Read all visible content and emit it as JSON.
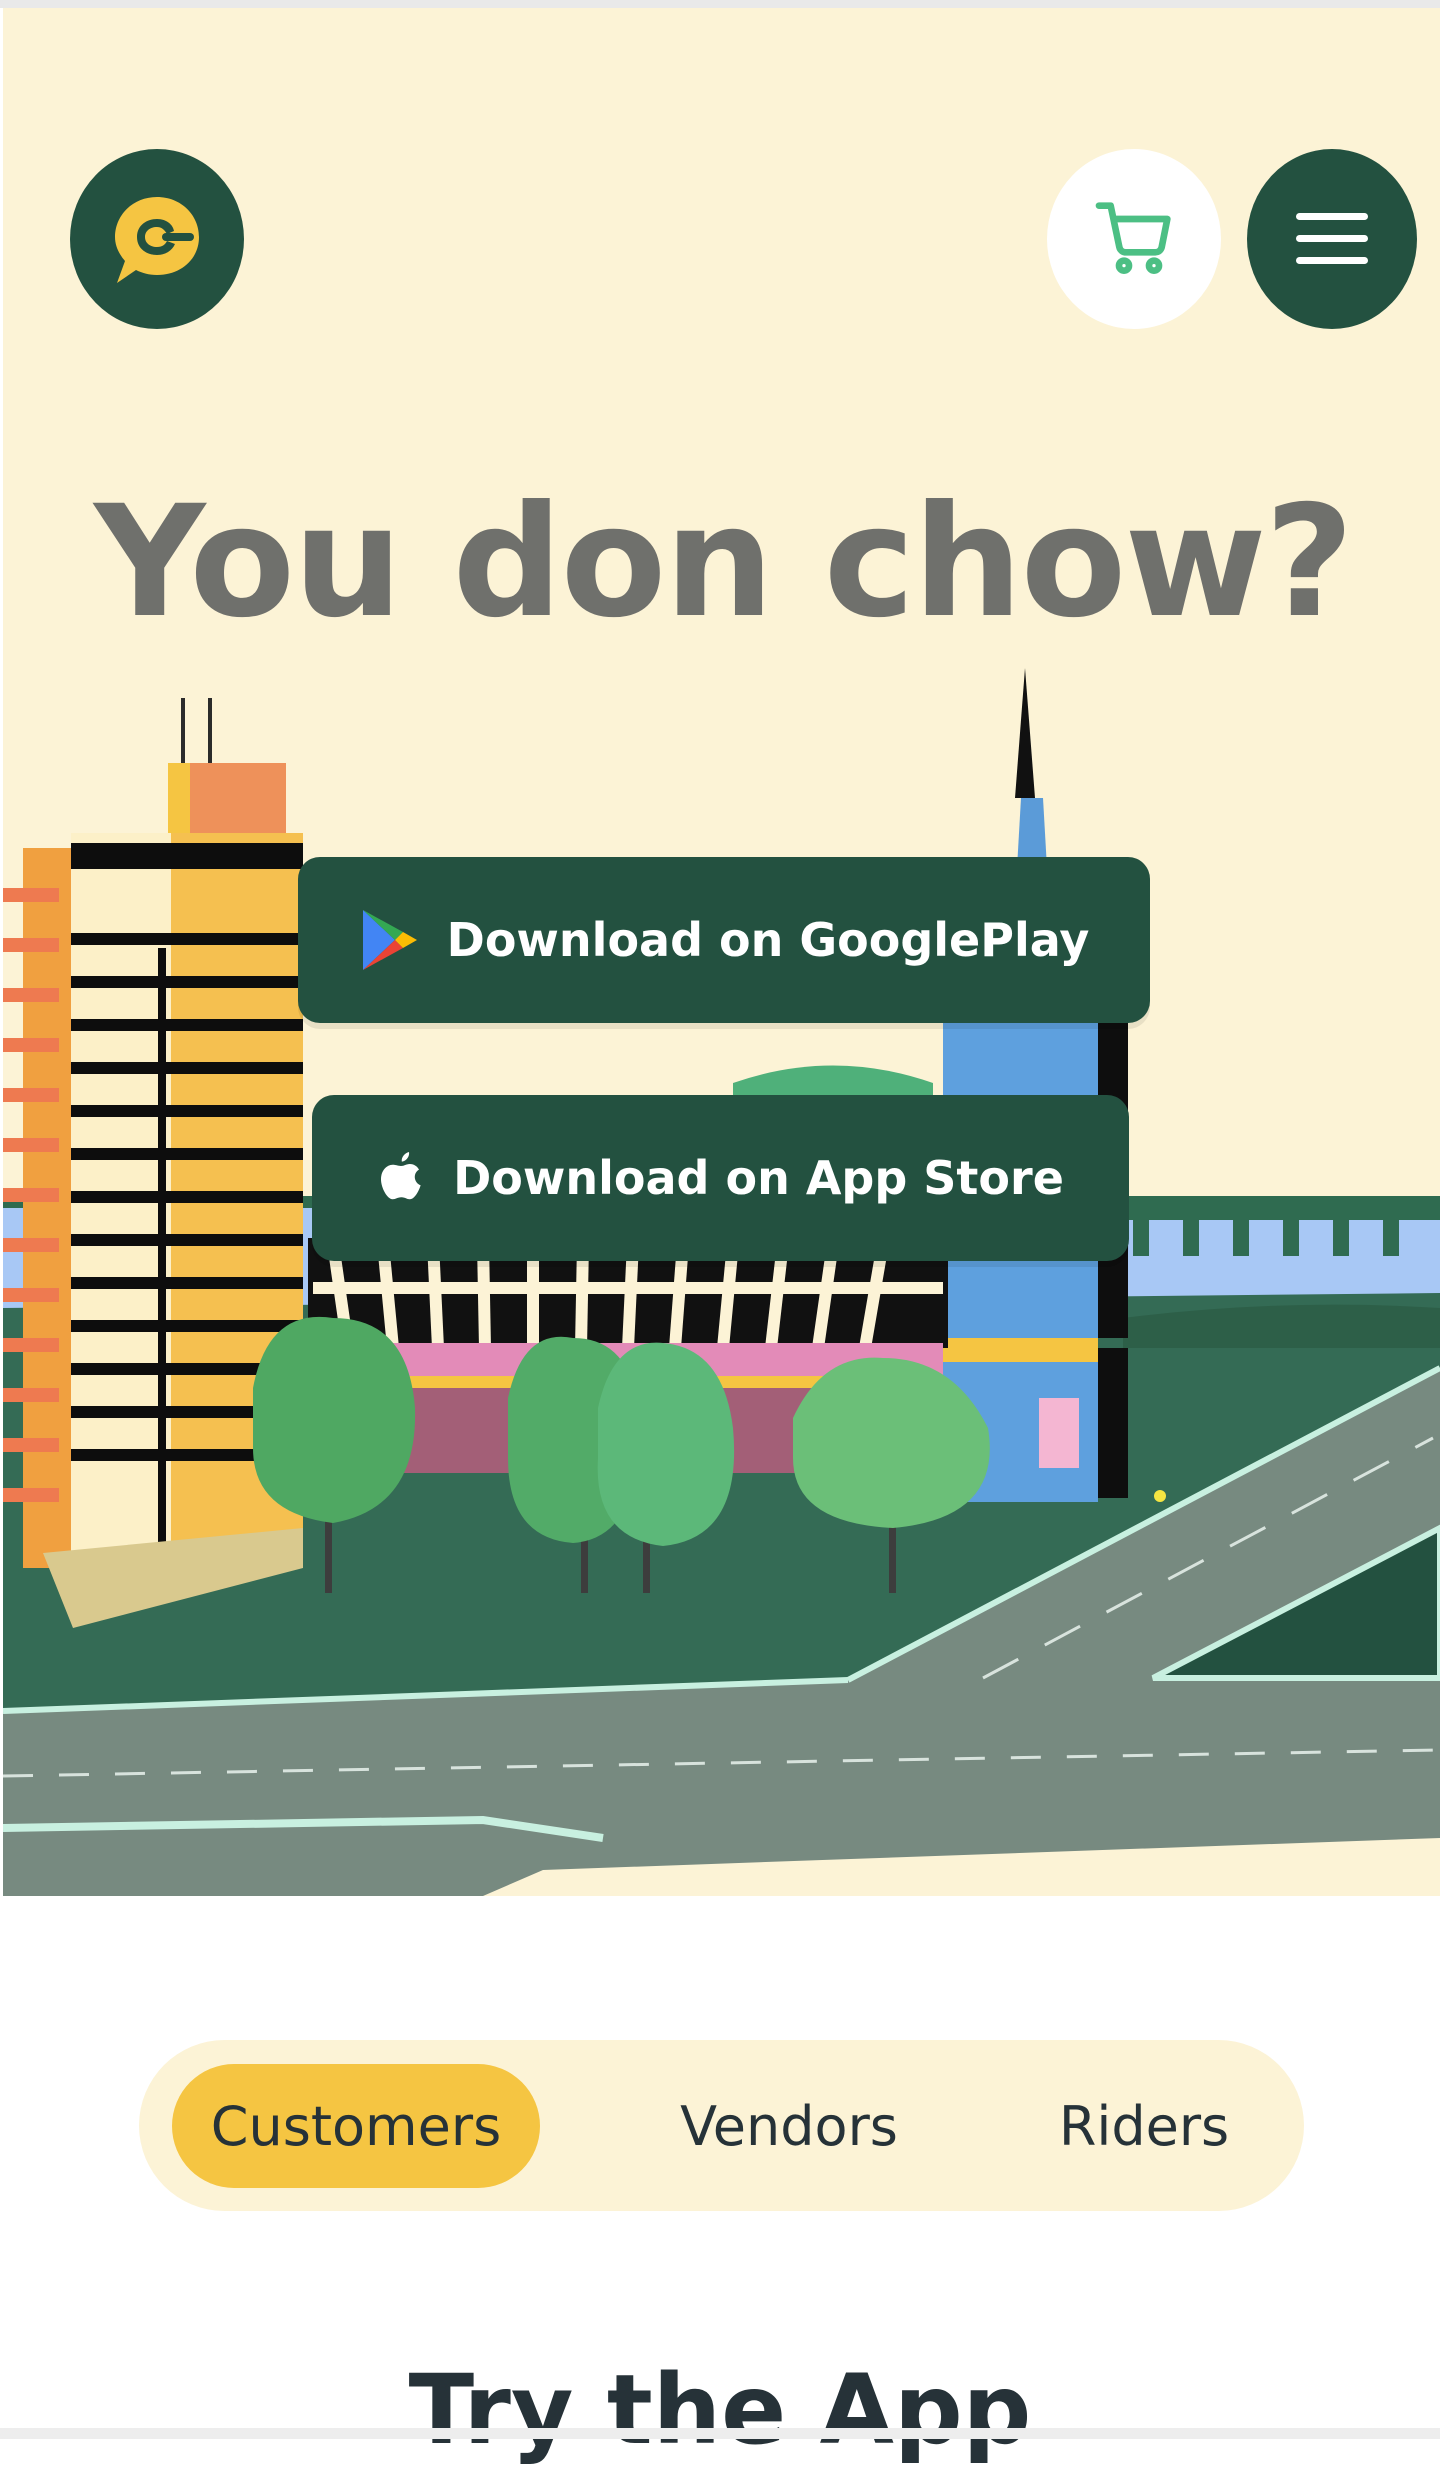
{
  "header": {
    "logo_icon": "chat-bubble-logo-icon",
    "cart_icon": "shopping-cart-icon",
    "menu_icon": "hamburger-menu-icon"
  },
  "hero": {
    "headline": "You don chow?",
    "googleplay_label": "Download on GooglePlay",
    "appstore_label": "Download on App Store"
  },
  "audience_tabs": {
    "items": [
      {
        "label": "Customers",
        "active": true
      },
      {
        "label": "Vendors",
        "active": false
      },
      {
        "label": "Riders",
        "active": false
      }
    ]
  },
  "section": {
    "title": "Try the App"
  },
  "colors": {
    "brand_green": "#235140",
    "cream": "#fcf3d6",
    "accent_yellow": "#f5c542",
    "headline_gray": "#6f706c",
    "cart_green": "#4cbf84"
  }
}
